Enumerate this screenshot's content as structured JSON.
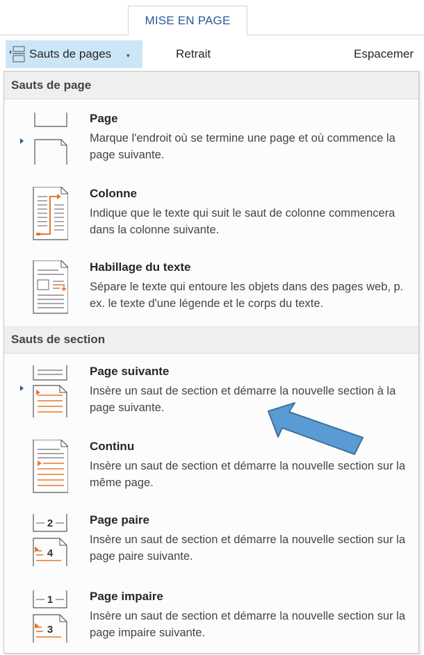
{
  "ribbon": {
    "active_tab": "MISE EN PAGE",
    "breaks_button_label": "Sauts de pages",
    "breaks_caret": "▾",
    "retrait_label": "Retrait",
    "espacement_label": "Espacemer"
  },
  "menu": {
    "page_breaks_header": "Sauts de page",
    "page_breaks": [
      {
        "title": "Page",
        "desc": "Marque l'endroit où se termine une page et où commence la page suivante.",
        "icon": "page-break-icon"
      },
      {
        "title": "Colonne",
        "desc": "Indique que le texte qui suit le saut de colonne commencera dans la colonne suivante.",
        "icon": "column-break-icon"
      },
      {
        "title": "Habillage du texte",
        "desc": "Sépare le texte qui entoure les objets dans des pages web, p. ex. le texte d'une légende et le corps du texte.",
        "icon": "text-wrapping-icon"
      }
    ],
    "section_breaks_header": "Sauts de section",
    "section_breaks": [
      {
        "title": "Page suivante",
        "desc": "Insère un saut de section et démarre la nouvelle section à la page suivante.",
        "icon": "next-page-section-icon"
      },
      {
        "title": "Continu",
        "desc": "Insère un saut de section et démarre la nouvelle section sur la même page.",
        "icon": "continuous-section-icon"
      },
      {
        "title": "Page paire",
        "desc": "Insère un saut de section et démarre la nouvelle section sur la page paire suivante.",
        "icon": "even-page-section-icon",
        "badge_top": "2",
        "badge_bottom": "4"
      },
      {
        "title": "Page impaire",
        "desc": "Insère un saut de section et démarre la nouvelle section sur la page impaire suivante.",
        "icon": "odd-page-section-icon",
        "badge_top": "1",
        "badge_bottom": "3"
      }
    ]
  },
  "colors": {
    "accent_blue": "#2b579a",
    "highlight": "#cde6f7",
    "icon_orange": "#e8762d",
    "arrow_blue": "#5b9bd5"
  }
}
